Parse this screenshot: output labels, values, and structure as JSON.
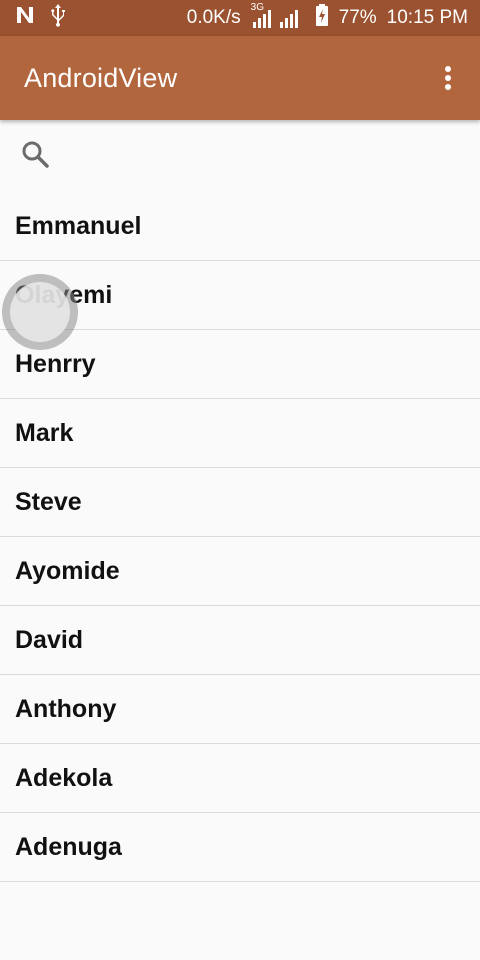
{
  "status_bar": {
    "net_speed": "0.0K/s",
    "network_type": "3G",
    "battery": "77%",
    "time": "10:15 PM",
    "icons": [
      "n-notification-icon",
      "usb-icon",
      "signal-icon",
      "battery-charging-icon"
    ]
  },
  "app_bar": {
    "title": "AndroidView",
    "overflow_icon": "more-vert-icon",
    "color": "#b2663d"
  },
  "search": {
    "icon": "search-icon",
    "value": "",
    "placeholder": ""
  },
  "list": {
    "items": [
      {
        "label": "Emmanuel"
      },
      {
        "label": "Olayemi"
      },
      {
        "label": "Henrry"
      },
      {
        "label": "Mark"
      },
      {
        "label": "Steve"
      },
      {
        "label": "Ayomide"
      },
      {
        "label": "David"
      },
      {
        "label": "Anthony"
      },
      {
        "label": "Adekola"
      },
      {
        "label": "Adenuga"
      }
    ]
  },
  "colors": {
    "status_bar": "#9b5230",
    "app_bar": "#b2663d",
    "background": "#fafafa",
    "divider": "#dadada"
  }
}
